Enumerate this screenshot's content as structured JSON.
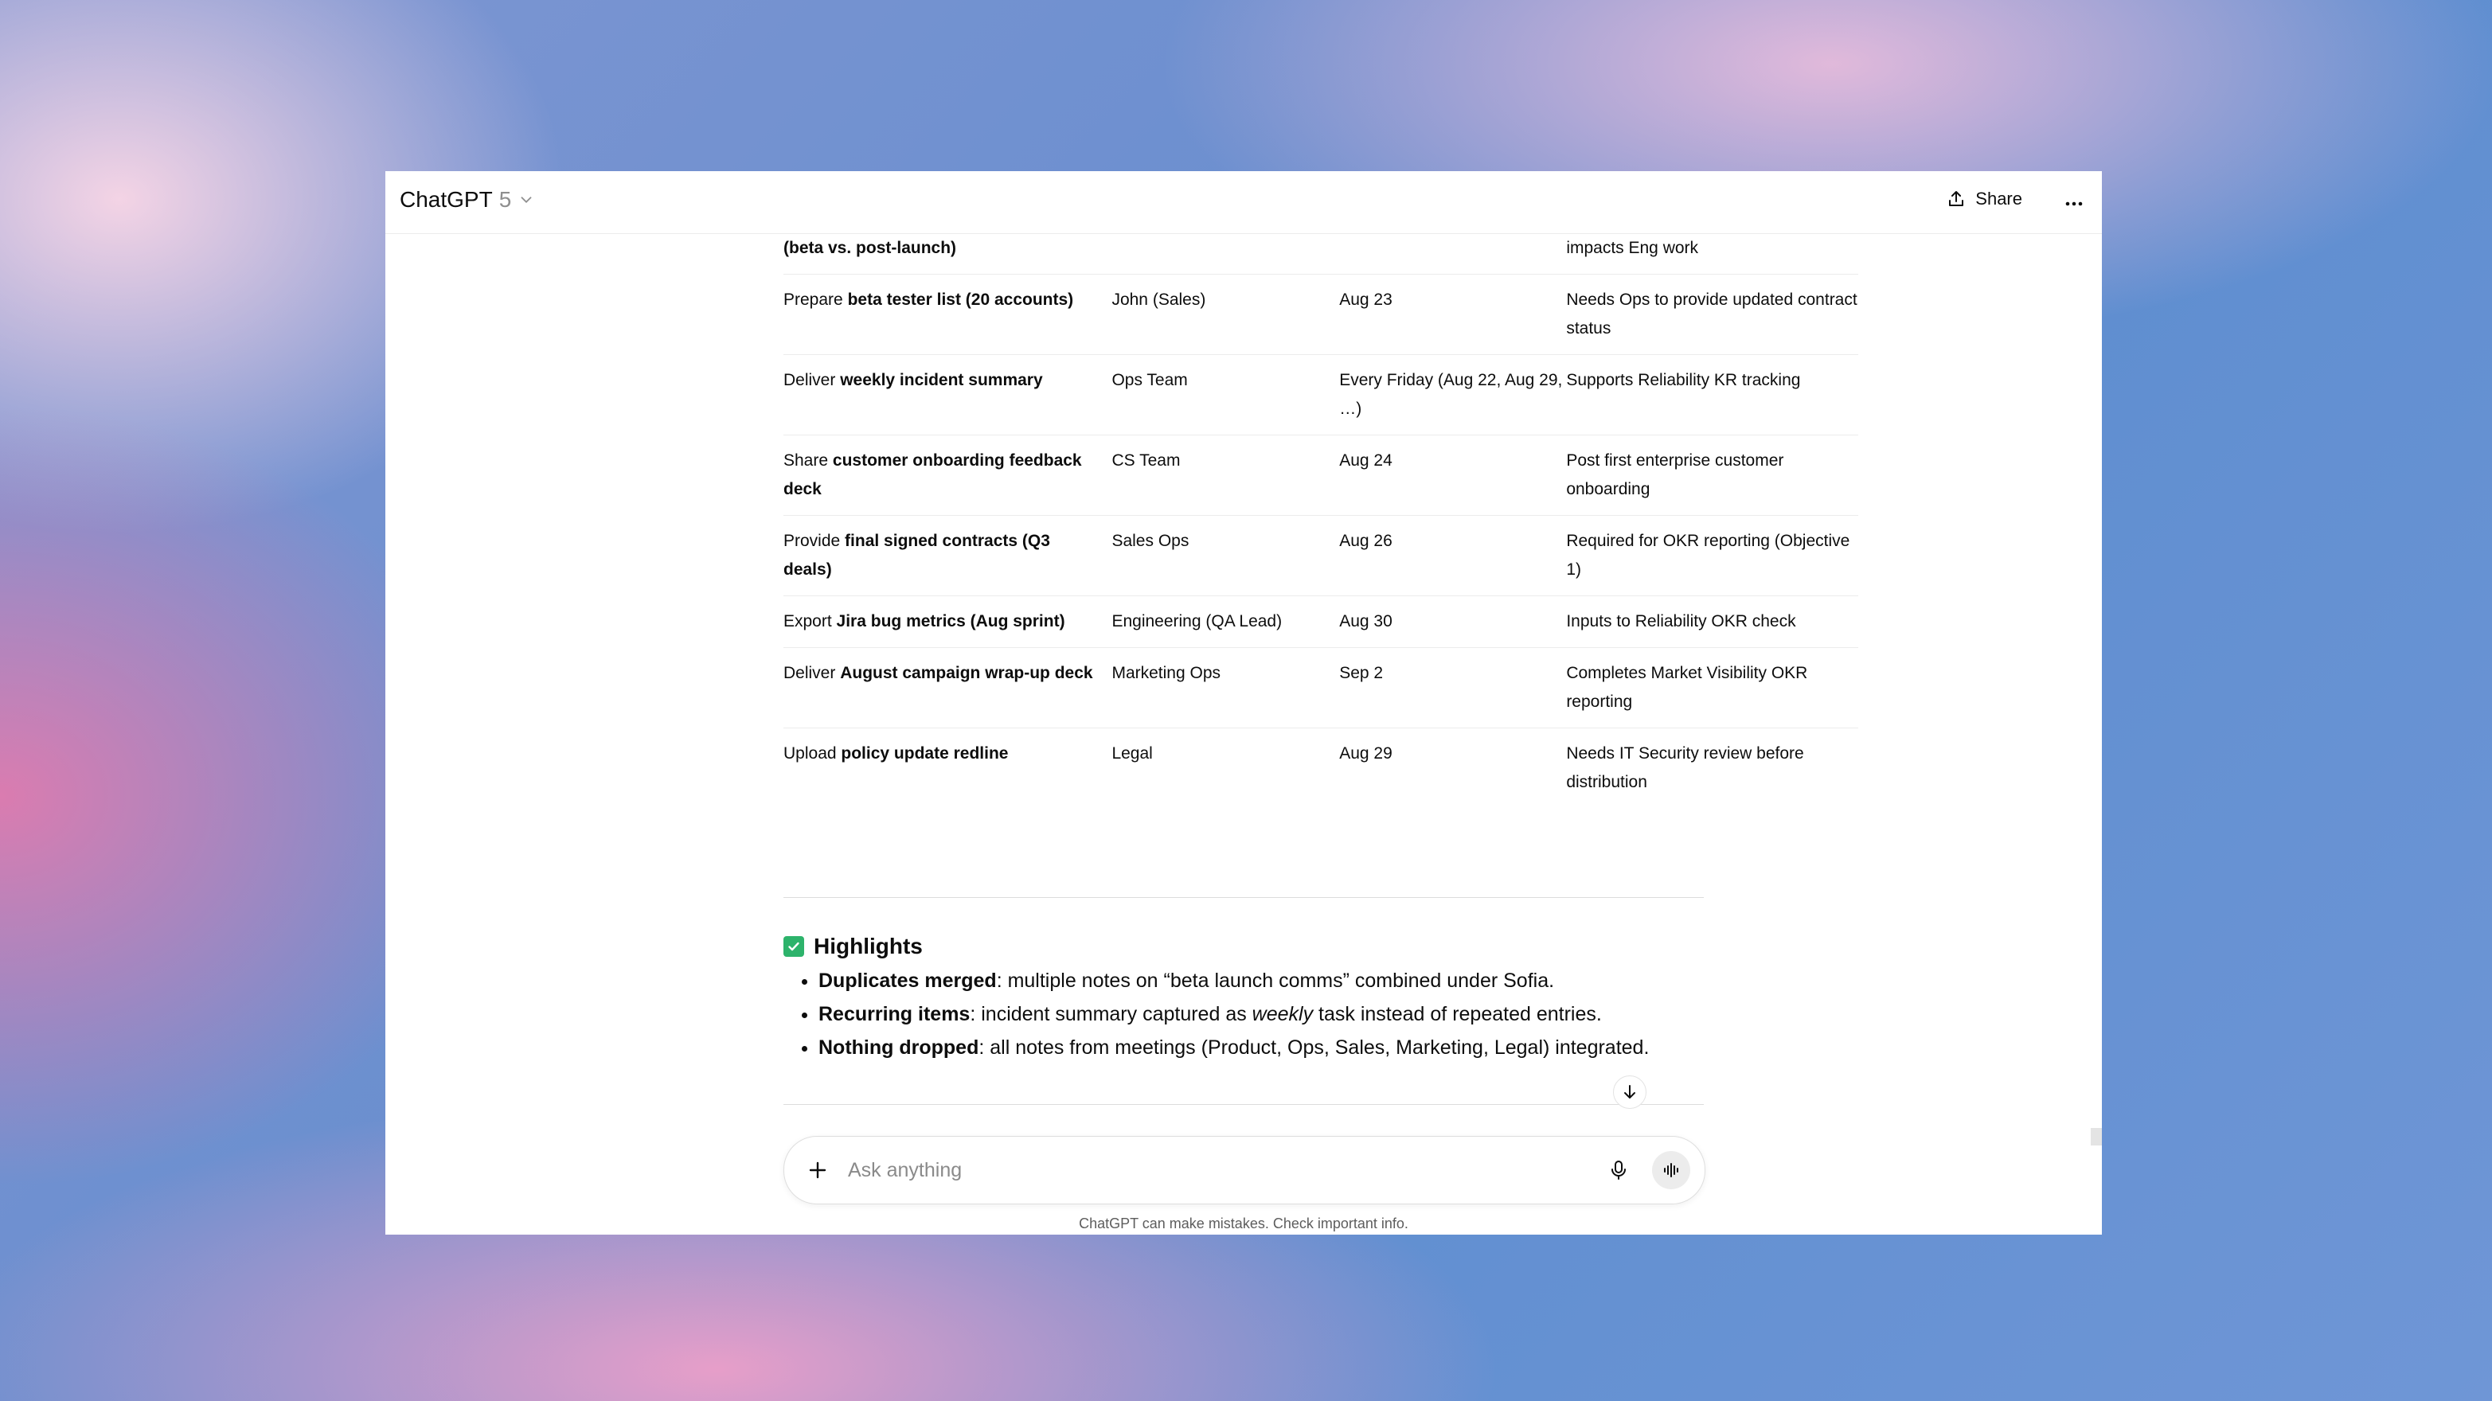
{
  "header": {
    "model_name": "ChatGPT",
    "model_version": "5",
    "share_label": "Share"
  },
  "table": {
    "partial_top": {
      "task": "(beta vs. post-launch)",
      "notes": "impacts Eng work"
    },
    "rows": [
      {
        "task_prefix": "Prepare",
        "task_bold": "beta tester list (20 accounts)",
        "task_suffix": "",
        "owner": "John (Sales)",
        "due": "Aug 23",
        "notes": "Needs Ops to provide updated contract status"
      },
      {
        "task_prefix": "Deliver",
        "task_bold": "weekly incident summary",
        "task_suffix": "",
        "owner": "Ops Team",
        "due": "Every Friday (Aug 22, Aug 29, …)",
        "notes": "Supports Reliability KR tracking"
      },
      {
        "task_prefix": "Share",
        "task_bold": "customer onboarding feedback deck",
        "task_suffix": "",
        "owner": "CS Team",
        "due": "Aug 24",
        "notes": "Post first enterprise customer onboarding"
      },
      {
        "task_prefix": "Provide",
        "task_bold": "final signed contracts (Q3 deals)",
        "task_suffix": "",
        "owner": "Sales Ops",
        "due": "Aug 26",
        "notes": "Required for OKR reporting (Objective 1)"
      },
      {
        "task_prefix": "Export",
        "task_bold": "Jira bug metrics (Aug sprint)",
        "task_suffix": "",
        "owner": "Engineering (QA Lead)",
        "due": "Aug 30",
        "notes": "Inputs to Reliability OKR check"
      },
      {
        "task_prefix": "Deliver",
        "task_bold": "August campaign wrap-up deck",
        "task_suffix": "",
        "owner": "Marketing Ops",
        "due": "Sep 2",
        "notes": "Completes Market Visibility OKR reporting"
      },
      {
        "task_prefix": "Upload",
        "task_bold": "policy update redline",
        "task_suffix": "",
        "owner": "Legal",
        "due": "Aug 29",
        "notes": "Needs IT Security review before distribution"
      }
    ]
  },
  "highlights": {
    "title": "Highlights",
    "items": [
      {
        "bold": "Duplicates merged",
        "text_a": ": multiple notes on “beta launch comms” combined under Sofia.",
        "italic": "",
        "text_b": ""
      },
      {
        "bold": "Recurring items",
        "text_a": ": incident summary captured as ",
        "italic": "weekly",
        "text_b": " task instead of repeated entries."
      },
      {
        "bold": "Nothing dropped",
        "text_a": ": all notes from meetings (Product, Ops, Sales, Marketing, Legal) integrated.",
        "italic": "",
        "text_b": ""
      }
    ]
  },
  "composer": {
    "placeholder": "Ask anything"
  },
  "footer": {
    "disclaimer": "ChatGPT can make mistakes. Check important info."
  },
  "icons": {
    "check": "check-square-icon",
    "share": "share-icon",
    "more": "more-dots-icon",
    "plus": "plus-icon",
    "mic": "mic-icon",
    "voice": "voice-waveform-icon",
    "scroll": "arrow-down-icon"
  },
  "colors": {
    "check_green": "#2db36b"
  }
}
